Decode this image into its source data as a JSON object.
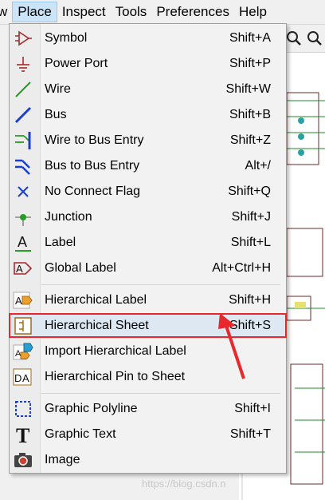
{
  "menubar": {
    "items": [
      {
        "label": "w"
      },
      {
        "label": "Place"
      },
      {
        "label": "Inspect"
      },
      {
        "label": "Tools"
      },
      {
        "label": "Preferences"
      },
      {
        "label": "Help"
      }
    ]
  },
  "menu": {
    "items": [
      {
        "label": "Symbol",
        "shortcut": "Shift+A",
        "icon": "symbol-icon"
      },
      {
        "label": "Power Port",
        "shortcut": "Shift+P",
        "icon": "power-port-icon"
      },
      {
        "label": "Wire",
        "shortcut": "Shift+W",
        "icon": "wire-icon"
      },
      {
        "label": "Bus",
        "shortcut": "Shift+B",
        "icon": "bus-icon"
      },
      {
        "label": "Wire to Bus Entry",
        "shortcut": "Shift+Z",
        "icon": "wire-to-bus-entry-icon"
      },
      {
        "label": "Bus to Bus Entry",
        "shortcut": "Alt+/",
        "icon": "bus-to-bus-entry-icon"
      },
      {
        "label": "No Connect Flag",
        "shortcut": "Shift+Q",
        "icon": "no-connect-icon"
      },
      {
        "label": "Junction",
        "shortcut": "Shift+J",
        "icon": "junction-icon"
      },
      {
        "label": "Label",
        "shortcut": "Shift+L",
        "icon": "label-icon"
      },
      {
        "label": "Global Label",
        "shortcut": "Alt+Ctrl+H",
        "icon": "global-label-icon"
      },
      {
        "label": "Hierarchical Label",
        "shortcut": "Shift+H",
        "icon": "hierarchical-label-icon"
      },
      {
        "label": "Hierarchical Sheet",
        "shortcut": "Shift+S",
        "icon": "hierarchical-sheet-icon"
      },
      {
        "label": "Import Hierarchical Label",
        "shortcut": "",
        "icon": "import-hierarchical-label-icon"
      },
      {
        "label": "Hierarchical Pin to Sheet",
        "shortcut": "",
        "icon": "hierarchical-pin-icon"
      },
      {
        "label": "Graphic Polyline",
        "shortcut": "Shift+I",
        "icon": "graphic-polyline-icon"
      },
      {
        "label": "Graphic Text",
        "shortcut": "Shift+T",
        "icon": "graphic-text-icon"
      },
      {
        "label": "Image",
        "shortcut": "",
        "icon": "image-icon"
      }
    ]
  },
  "watermark": "https://blog.csdn.n",
  "colors": {
    "highlight": "#e8282c",
    "wire": "#22a020",
    "bus": "#1a3fd0",
    "symbol": "#a82a2a"
  }
}
